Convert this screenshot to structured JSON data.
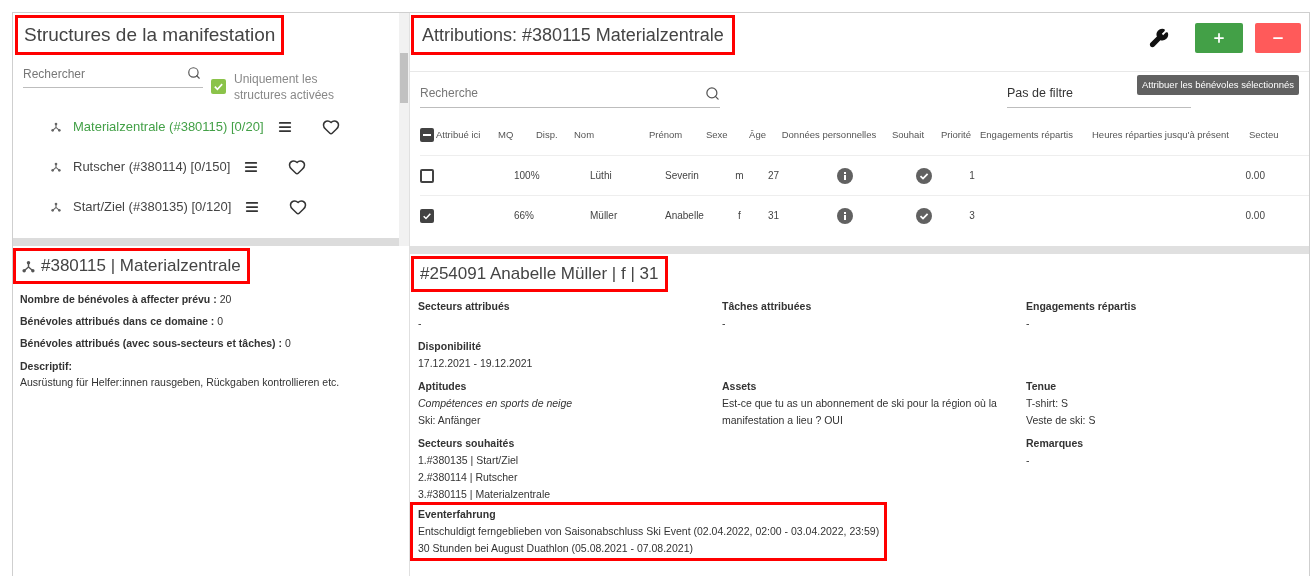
{
  "structures": {
    "title": "Structures de la manifestation",
    "highlighted": true,
    "search": {
      "placeholder": "Rechercher"
    },
    "only_active": {
      "label": "Uniquement les structures activées",
      "checked": true
    },
    "tree": [
      {
        "label": "Materialzentrale (#380115) [0/20]",
        "selected": true
      },
      {
        "label": "Rutscher (#380114) [0/150]",
        "selected": false
      },
      {
        "label": "Start/Ziel (#380135) [0/120]",
        "selected": false
      }
    ]
  },
  "structure_detail": {
    "title": "#380115 | Materialzentrale",
    "highlighted": true,
    "fields": [
      {
        "label": "Nombre de bénévoles à affecter prévu :",
        "value": "20"
      },
      {
        "label": "Bénévoles attribués dans ce domaine :",
        "value": "0"
      },
      {
        "label": "Bénévoles attribués (avec sous-secteurs et tâches) :",
        "value": "0"
      }
    ],
    "description": {
      "label": "Descriptif:",
      "value": "Ausrüstung für Helfer:innen rausgeben, Rückgaben kontrollieren etc."
    }
  },
  "attributions": {
    "title": "Attributions: #380115 Materialzentrale",
    "highlighted": true,
    "tooltip": "Attribuer les bénévoles sélectionnés",
    "search": {
      "placeholder": "Recherche"
    },
    "filter": {
      "value": "Pas de filtre"
    },
    "table": {
      "select_all_partial": true,
      "columns": [
        "Attribué ici",
        "MQ",
        "Disp.",
        "Nom",
        "Prénom",
        "Sexe",
        "Âge",
        "Données personnelles",
        "Souhait",
        "Priorité",
        "Engagements répartis",
        "Heures réparties jusqu'à présent",
        "Secteu"
      ],
      "rows": [
        {
          "checked": false,
          "mq": "100%",
          "nom": "Lüthi",
          "prenom": "Severin",
          "sexe": "m",
          "age": "27",
          "priorite": "1",
          "heures": "0.00"
        },
        {
          "checked": true,
          "mq": "66%",
          "nom": "Müller",
          "prenom": "Anabelle",
          "sexe": "f",
          "age": "31",
          "priorite": "3",
          "heures": "0.00"
        }
      ]
    }
  },
  "volunteer": {
    "title": "#254091 Anabelle Müller | f | 31",
    "highlighted": true,
    "rows": [
      [
        {
          "label": "Secteurs attribués",
          "lines": [
            {
              "text": "-",
              "italic": false
            }
          ]
        },
        {
          "label": "Tâches attribuées",
          "lines": [
            {
              "text": "-",
              "italic": false
            }
          ]
        },
        {
          "label": "Engagements répartis",
          "lines": [
            {
              "text": "-",
              "italic": false
            }
          ]
        }
      ],
      [
        {
          "label": "Disponibilité",
          "lines": [
            {
              "text": "17.12.2021 - 19.12.2021",
              "italic": false
            }
          ]
        },
        "",
        ""
      ],
      [
        {
          "label": "Aptitudes",
          "lines": [
            {
              "text": "Compétences en sports de neige",
              "italic": true
            },
            {
              "text": "Ski: Anfänger",
              "italic": false
            }
          ]
        },
        {
          "label": "Assets",
          "lines": [
            {
              "text": "Est-ce que tu as un abonnement de ski pour la région où la manifestation a lieu ? OUI",
              "italic": false
            }
          ]
        },
        {
          "label": "Tenue",
          "lines": [
            {
              "text": "T-shirt: S",
              "italic": false
            },
            {
              "text": "Veste de ski: S",
              "italic": false
            }
          ]
        }
      ],
      [
        {
          "label": "Secteurs souhaités",
          "lines": [
            {
              "text": "1.#380135 | Start/Ziel",
              "italic": false
            },
            {
              "text": "2.#380114 | Rutscher",
              "italic": false
            },
            {
              "text": "3.#380115 | Materialzentrale",
              "italic": false
            }
          ]
        },
        "",
        {
          "label": "Remarques",
          "lines": [
            {
              "text": "-",
              "italic": false
            }
          ]
        }
      ]
    ],
    "experience": {
      "label": "Eventerfahrung",
      "highlighted": true,
      "lines": [
        "Entschuldigt ferngeblieben von Saisonabschluss Ski Event (02.04.2022, 02:00 - 03.04.2022, 23:59)",
        "30 Stunden bei August Duathlon (05.08.2021 - 07.08.2021)"
      ]
    }
  }
}
